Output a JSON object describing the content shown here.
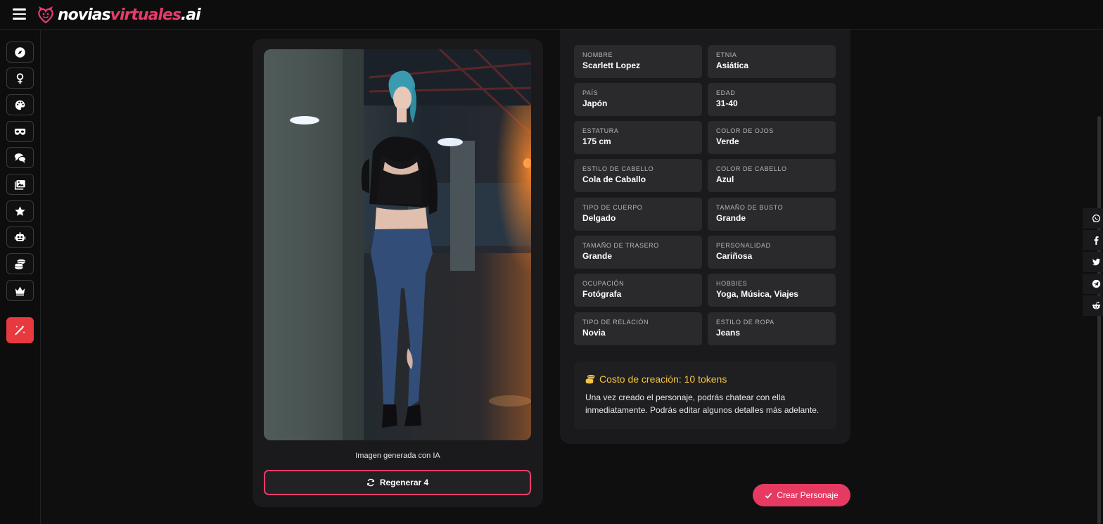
{
  "header": {
    "logo_part1": "novias",
    "logo_part2": "virtuales",
    "logo_part3": ".ai",
    "menu_icon": "hamburger-icon"
  },
  "sidebar": {
    "items": [
      {
        "icon": "compass-icon"
      },
      {
        "icon": "female-symbol-icon"
      },
      {
        "icon": "palette-icon"
      },
      {
        "icon": "mask-icon"
      },
      {
        "icon": "chat-bubbles-icon"
      },
      {
        "icon": "gallery-icon"
      },
      {
        "icon": "star-icon"
      },
      {
        "icon": "robot-icon"
      },
      {
        "icon": "coins-icon"
      },
      {
        "icon": "crown-icon"
      },
      {
        "icon": "magic-wand-icon"
      }
    ],
    "accent": "#e8393e"
  },
  "preview": {
    "caption": "Imagen generada con IA",
    "regen_label": "Regenerar 4"
  },
  "details": {
    "fields": [
      {
        "label": "NOMBRE",
        "value": "Scarlett Lopez"
      },
      {
        "label": "ETNIA",
        "value": "Asiática"
      },
      {
        "label": "PAÍS",
        "value": "Japón"
      },
      {
        "label": "EDAD",
        "value": "31-40"
      },
      {
        "label": "ESTATURA",
        "value": "175 cm"
      },
      {
        "label": "COLOR DE OJOS",
        "value": "Verde"
      },
      {
        "label": "ESTILO DE CABELLO",
        "value": "Cola de Caballo"
      },
      {
        "label": "COLOR DE CABELLO",
        "value": "Azul"
      },
      {
        "label": "TIPO DE CUERPO",
        "value": "Delgado"
      },
      {
        "label": "TAMAÑO DE BUSTO",
        "value": "Grande"
      },
      {
        "label": "TAMAÑO DE TRASERO",
        "value": "Grande"
      },
      {
        "label": "PERSONALIDAD",
        "value": "Cariñosa"
      },
      {
        "label": "OCUPACIÓN",
        "value": "Fotógrafa"
      },
      {
        "label": "HOBBIES",
        "value": "Yoga, Música, Viajes"
      },
      {
        "label": "TIPO DE RELACIÓN",
        "value": "Novia"
      },
      {
        "label": "ESTILO DE ROPA",
        "value": "Jeans"
      }
    ],
    "cost_title": "Costo de creación: 10 tokens",
    "cost_text": "Una vez creado el personaje, podrás chatear con ella inmediatamente. Podrás editar algunos detalles más adelante."
  },
  "actions": {
    "create_label": "Crear Personaje",
    "brand_color": "#e63a62"
  },
  "share": {
    "items": [
      {
        "icon": "whatsapp-icon"
      },
      {
        "icon": "facebook-icon"
      },
      {
        "icon": "twitter-icon"
      },
      {
        "icon": "telegram-icon"
      },
      {
        "icon": "reddit-icon"
      }
    ]
  }
}
